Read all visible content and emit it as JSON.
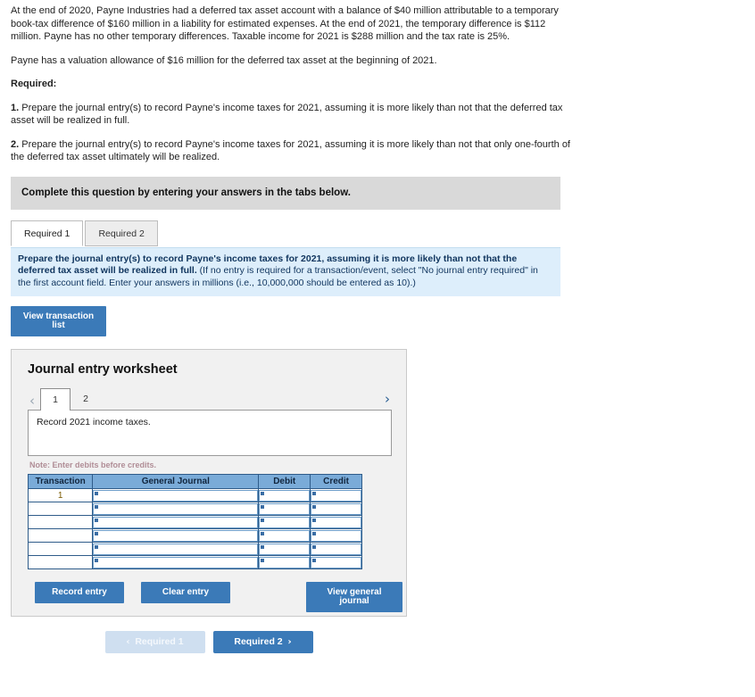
{
  "problem": {
    "paragraph1": "At the end of 2020, Payne Industries had a deferred tax asset account with a balance of $40 million attributable to a temporary book-tax difference of $160 million in a liability for estimated expenses. At the end of 2021, the temporary difference is $112 million. Payne has no other temporary differences. Taxable income for 2021 is $288 million and the tax rate is 25%.",
    "paragraph2": "Payne has a valuation allowance of $16 million for the deferred tax asset at the beginning of 2021.",
    "required_heading": "Required:",
    "requirement_1_num": "1.",
    "requirement_1_text": " Prepare the journal entry(s) to record Payne's income taxes for 2021, assuming it is more likely than not that the deferred tax asset will be realized in full.",
    "requirement_2_num": "2.",
    "requirement_2_text": " Prepare the journal entry(s) to record Payne's income taxes for 2021, assuming it is more likely than not that only one-fourth of the deferred tax asset ultimately will be realized."
  },
  "gray_banner": {
    "text": "Complete this question by entering your answers in the tabs below."
  },
  "tabs": [
    {
      "label": "Required 1",
      "active": true
    },
    {
      "label": "Required 2",
      "active": false
    }
  ],
  "blue_banner": {
    "bold_text": "Prepare the journal entry(s) to record Payne's income taxes for 2021, assuming it is more likely than not that the deferred tax asset will be realized in full.",
    "normal_text": " (If no entry is required for a transaction/event, select \"No journal entry required\" in the first account field. Enter your answers in millions (i.e., 10,000,000 should be entered as 10).)"
  },
  "view_transaction_button": {
    "label": "View transaction list"
  },
  "worksheet": {
    "title": "Journal entry worksheet",
    "pager": {
      "prev_icon": "chevron-left",
      "next_icon": "chevron-right",
      "pages": [
        {
          "label": "1",
          "active": true
        },
        {
          "label": "2",
          "active": false
        }
      ]
    },
    "description": "Record 2021 income taxes.",
    "note": "Note: Enter debits before credits.",
    "table": {
      "headers": [
        "Transaction",
        "General Journal",
        "Debit",
        "Credit"
      ],
      "rows": [
        {
          "transaction": "1",
          "general_journal": "",
          "debit": "",
          "credit": ""
        },
        {
          "transaction": "",
          "general_journal": "",
          "debit": "",
          "credit": ""
        },
        {
          "transaction": "",
          "general_journal": "",
          "debit": "",
          "credit": ""
        },
        {
          "transaction": "",
          "general_journal": "",
          "debit": "",
          "credit": ""
        },
        {
          "transaction": "",
          "general_journal": "",
          "debit": "",
          "credit": ""
        },
        {
          "transaction": "",
          "general_journal": "",
          "debit": "",
          "credit": ""
        }
      ]
    },
    "actions": {
      "record_entry": "Record entry",
      "clear_entry": "Clear entry",
      "view_general_journal": "View general journal"
    }
  },
  "bottom_nav": {
    "prev_label": "Required 1",
    "next_label": "Required 2",
    "prev_icon": "chevron-left",
    "next_icon": "chevron-right"
  },
  "colors": {
    "primary_blue": "#3b7ab8",
    "table_header_blue": "#7aabd8",
    "banner_gray": "#d9d9d9",
    "banner_blue": "#ddeefb",
    "panel_gray": "#f1f1f1",
    "disabled_blue": "#cfdff0"
  }
}
